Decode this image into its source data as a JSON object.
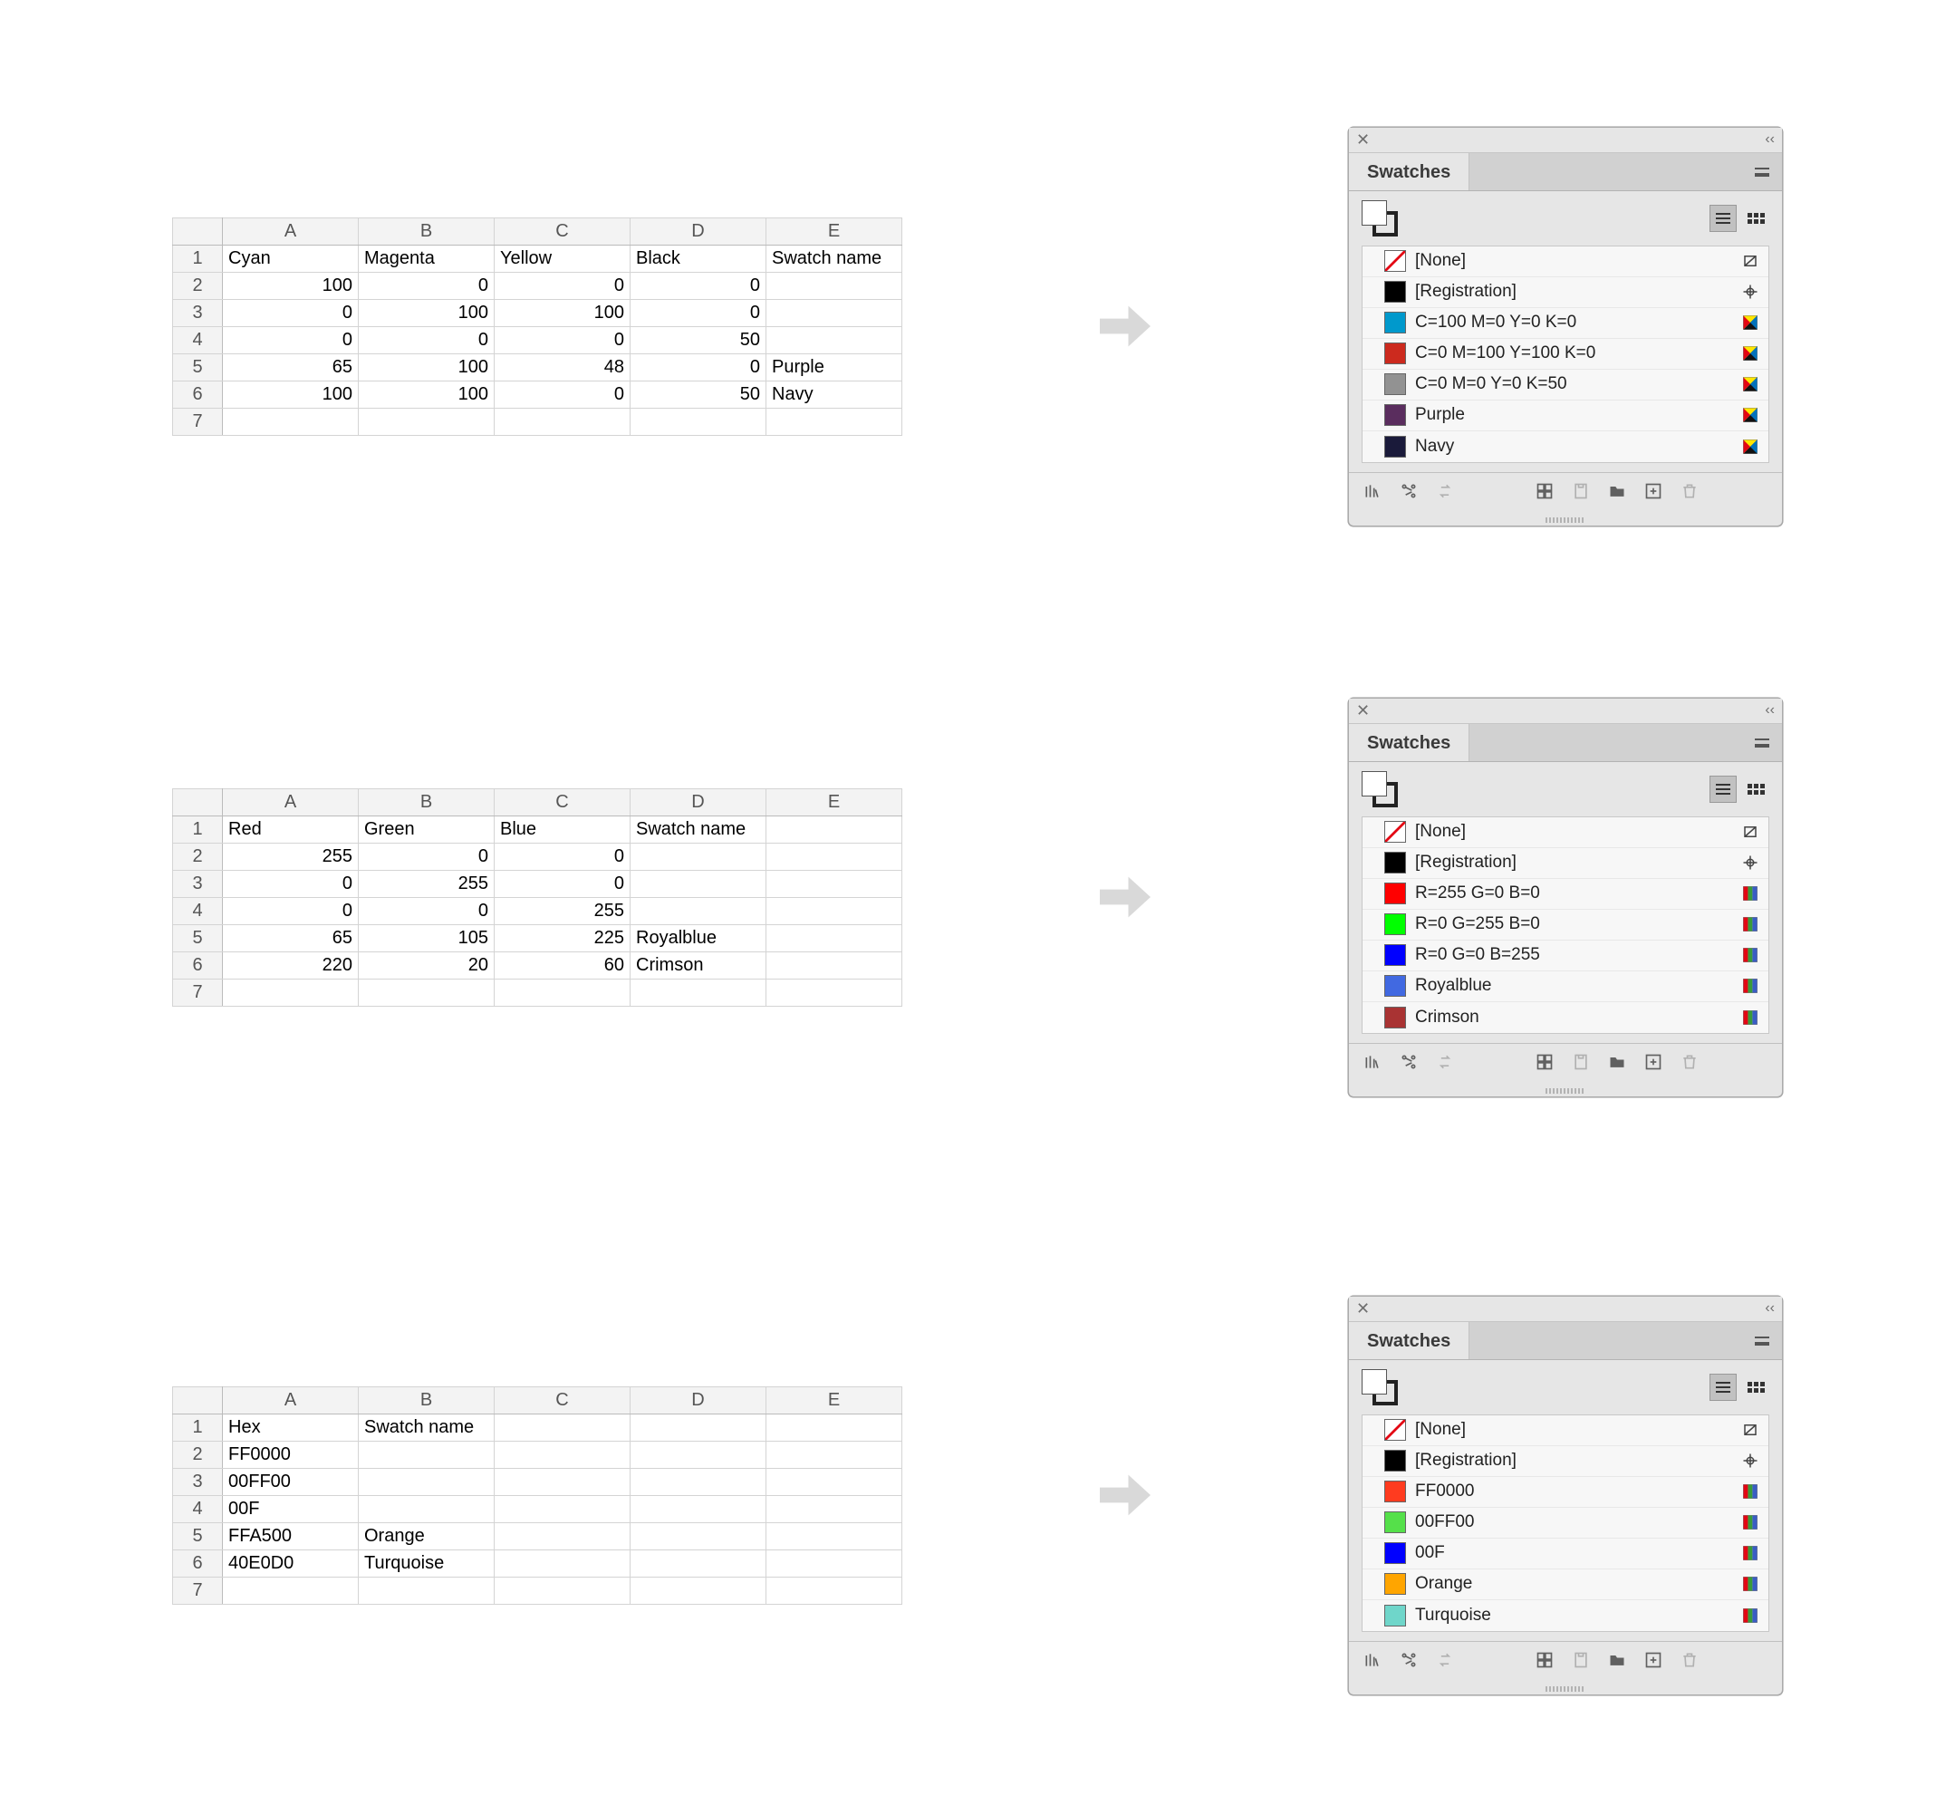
{
  "spreadsheet_columns": [
    "A",
    "B",
    "C",
    "D",
    "E"
  ],
  "row_numbers": [
    "1",
    "2",
    "3",
    "4",
    "5",
    "6",
    "7"
  ],
  "panel_title": "Swatches",
  "default_swatches": {
    "none": "[None]",
    "registration": "[Registration]"
  },
  "sections": [
    {
      "id": "cmyk",
      "sheet": {
        "headers": [
          "Cyan",
          "Magenta",
          "Yellow",
          "Black",
          "Swatch name"
        ],
        "rows": [
          {
            "cells": [
              "100",
              "0",
              "0",
              "0",
              ""
            ]
          },
          {
            "cells": [
              "0",
              "100",
              "100",
              "0",
              ""
            ]
          },
          {
            "cells": [
              "0",
              "0",
              "0",
              "50",
              ""
            ]
          },
          {
            "cells": [
              "65",
              "100",
              "48",
              "0",
              "Purple"
            ]
          },
          {
            "cells": [
              "100",
              "100",
              "0",
              "50",
              "Navy"
            ]
          }
        ],
        "numeric_cols": 4
      },
      "swatches": [
        {
          "label": "C=100 M=0 Y=0 K=0",
          "color": "#0099cc",
          "badge": "process"
        },
        {
          "label": "C=0 M=100 Y=100 K=0",
          "color": "#cc2a1e",
          "badge": "process"
        },
        {
          "label": "C=0 M=0 Y=0 K=50",
          "color": "#929292",
          "badge": "process"
        },
        {
          "label": "Purple",
          "color": "#5a2d5e",
          "badge": "process"
        },
        {
          "label": "Navy",
          "color": "#1a1a3a",
          "badge": "process"
        }
      ]
    },
    {
      "id": "rgb",
      "sheet": {
        "headers": [
          "Red",
          "Green",
          "Blue",
          "Swatch name",
          ""
        ],
        "rows": [
          {
            "cells": [
              "255",
              "0",
              "0",
              "",
              ""
            ]
          },
          {
            "cells": [
              "0",
              "255",
              "0",
              "",
              ""
            ]
          },
          {
            "cells": [
              "0",
              "0",
              "255",
              "",
              ""
            ]
          },
          {
            "cells": [
              "65",
              "105",
              "225",
              "Royalblue",
              ""
            ]
          },
          {
            "cells": [
              "220",
              "20",
              "60",
              "Crimson",
              ""
            ]
          }
        ],
        "numeric_cols": 3
      },
      "swatches": [
        {
          "label": "R=255 G=0 B=0",
          "color": "#ff0000",
          "badge": "rgb"
        },
        {
          "label": "R=0 G=255 B=0",
          "color": "#00ff00",
          "badge": "rgb"
        },
        {
          "label": "R=0 G=0 B=255",
          "color": "#0000ff",
          "badge": "rgb"
        },
        {
          "label": "Royalblue",
          "color": "#4169e1",
          "badge": "rgb"
        },
        {
          "label": "Crimson",
          "color": "#a93333",
          "badge": "rgb"
        }
      ]
    },
    {
      "id": "hex",
      "sheet": {
        "headers": [
          "Hex",
          "Swatch name",
          "",
          "",
          ""
        ],
        "rows": [
          {
            "cells": [
              "FF0000",
              "",
              "",
              "",
              ""
            ]
          },
          {
            "cells": [
              "00FF00",
              "",
              "",
              "",
              ""
            ]
          },
          {
            "cells": [
              "00F",
              "",
              "",
              "",
              ""
            ]
          },
          {
            "cells": [
              "FFA500",
              "Orange",
              "",
              "",
              ""
            ]
          },
          {
            "cells": [
              "40E0D0",
              "Turquoise",
              "",
              "",
              ""
            ]
          }
        ],
        "numeric_cols": 0
      },
      "swatches": [
        {
          "label": "FF0000",
          "color": "#ff3b1f",
          "badge": "rgb"
        },
        {
          "label": "00FF00",
          "color": "#55e04a",
          "badge": "rgb"
        },
        {
          "label": "00F",
          "color": "#0000ff",
          "badge": "rgb"
        },
        {
          "label": "Orange",
          "color": "#ffa500",
          "badge": "rgb"
        },
        {
          "label": "Turquoise",
          "color": "#6fd6ca",
          "badge": "rgb"
        }
      ]
    }
  ]
}
